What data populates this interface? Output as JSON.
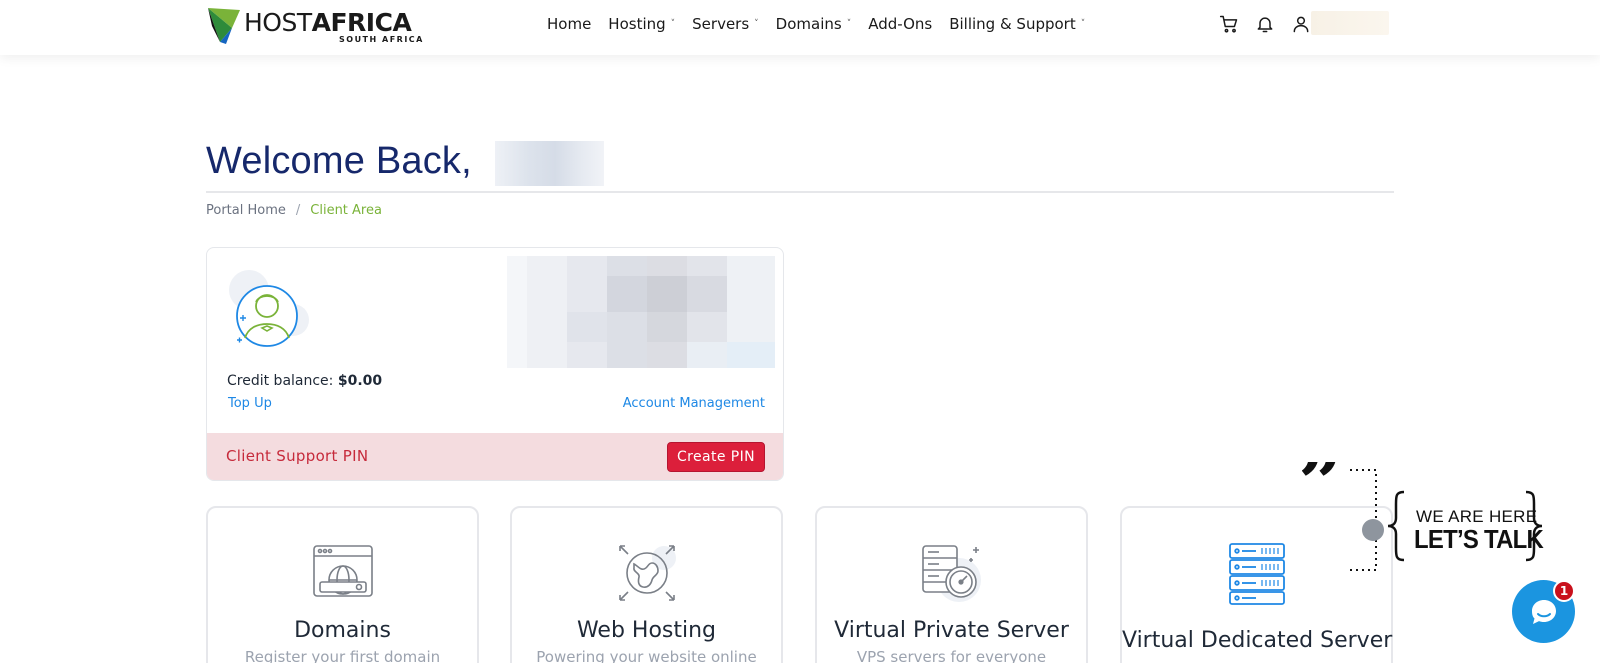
{
  "brand": {
    "name_light": "HOST",
    "name_bold": "AFRICA",
    "subtitle": "SOUTH AFRICA",
    "colors": {
      "green": "#7ab339",
      "blue": "#1565c0",
      "navy": "#16286b"
    }
  },
  "nav": {
    "items": [
      {
        "label": "Home",
        "has_dropdown": false
      },
      {
        "label": "Hosting",
        "has_dropdown": true
      },
      {
        "label": "Servers",
        "has_dropdown": true
      },
      {
        "label": "Domains",
        "has_dropdown": true
      },
      {
        "label": "Add-Ons",
        "has_dropdown": false
      },
      {
        "label": "Billing & Support",
        "has_dropdown": true
      }
    ],
    "caret": "˅"
  },
  "header_icons": [
    "cart-icon",
    "bell-icon",
    "user-icon"
  ],
  "welcome": {
    "text": "Welcome Back,"
  },
  "breadcrumb": {
    "home": "Portal Home",
    "separator": "/",
    "active": "Client Area"
  },
  "account": {
    "credit_label": "Credit balance:",
    "credit_value": "$0.00",
    "top_up": "Top Up",
    "account_management": "Account Management",
    "pin_label": "Client Support PIN",
    "pin_button": "Create PIN"
  },
  "tiles": [
    {
      "icon": "browser-globe-icon",
      "title": "Domains",
      "subtitle": "Register your first domain"
    },
    {
      "icon": "globe-arrows-icon",
      "title": "Web Hosting",
      "subtitle": "Powering your website online"
    },
    {
      "icon": "server-gauge-icon",
      "title": "Virtual Private Server",
      "subtitle": "VPS servers for everyone"
    },
    {
      "icon": "server-rack-icon",
      "title": "Virtual Dedicated Server",
      "subtitle": ""
    }
  ],
  "talk": {
    "line1": "WE ARE HERE",
    "line2": "LET’S TALK"
  },
  "chat": {
    "badge": "1"
  }
}
